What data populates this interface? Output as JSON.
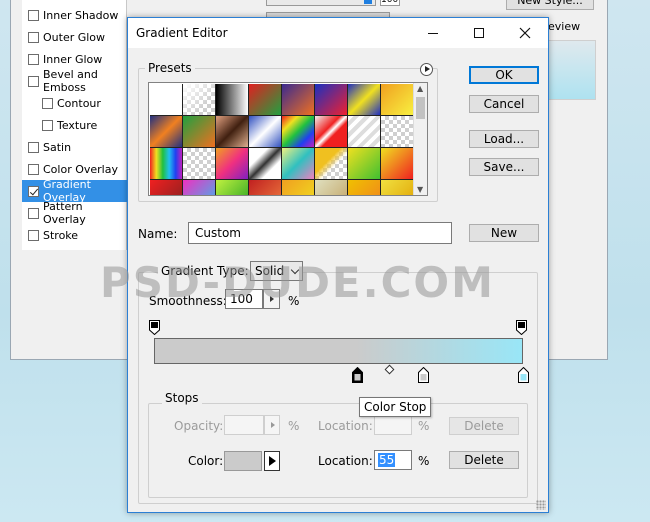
{
  "background_window": {
    "layer_styles": [
      {
        "label": "Inner Shadow",
        "checked": false,
        "indent": false,
        "selected": false
      },
      {
        "label": "Outer Glow",
        "checked": false,
        "indent": false,
        "selected": false
      },
      {
        "label": "Inner Glow",
        "checked": false,
        "indent": false,
        "selected": false
      },
      {
        "label": "Bevel and Emboss",
        "checked": false,
        "indent": false,
        "selected": false
      },
      {
        "label": "Contour",
        "checked": false,
        "indent": true,
        "selected": false
      },
      {
        "label": "Texture",
        "checked": false,
        "indent": true,
        "selected": false
      },
      {
        "label": "Satin",
        "checked": false,
        "indent": false,
        "selected": false
      },
      {
        "label": "Color Overlay",
        "checked": false,
        "indent": false,
        "selected": false
      },
      {
        "label": "Gradient Overlay",
        "checked": true,
        "indent": false,
        "selected": true
      },
      {
        "label": "Pattern Overlay",
        "checked": false,
        "indent": false,
        "selected": false
      },
      {
        "label": "Stroke",
        "checked": false,
        "indent": false,
        "selected": false
      }
    ],
    "new_style_label": "New Style...",
    "preview_label": "eview",
    "opacity_value": "100"
  },
  "dialog": {
    "title": "Gradient Editor",
    "presets_label": "Presets",
    "buttons": {
      "ok": "OK",
      "cancel": "Cancel",
      "load": "Load...",
      "save": "Save...",
      "new": "New"
    },
    "name_label": "Name:",
    "name_value": "Custom",
    "gradient_type_label": "Gradient Type:",
    "gradient_type_value": "Solid",
    "smoothness_label": "Smoothness:",
    "smoothness_value": "100",
    "percent": "%",
    "gradient": {
      "color_stops": [
        {
          "location": 55,
          "color": "#cbcbcb",
          "selected": true
        },
        {
          "location": 73,
          "color": "#cbcbcb",
          "selected": false
        },
        {
          "location": 100,
          "color": "#99e6f7",
          "selected": false
        }
      ],
      "midpoint_location": 64,
      "start_color": "#cbcbcb",
      "end_color": "#99e6f7"
    },
    "tooltip": "Color Stop",
    "stops": {
      "label": "Stops",
      "opacity_label": "Opacity:",
      "location_label": "Location:",
      "delete_label": "Delete",
      "color_label": "Color:",
      "color_location_value": "55",
      "stop_color": "#cbcbcb"
    }
  },
  "watermark": "PSD-DUDE.COM"
}
